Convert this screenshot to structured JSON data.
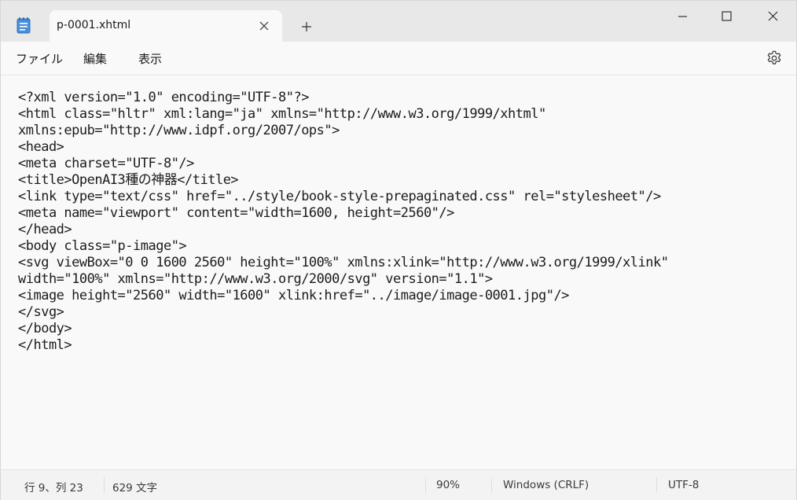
{
  "window": {
    "tab_title": "p-0001.xhtml",
    "new_tab_label": "+"
  },
  "menu": {
    "file": "ファイル",
    "edit": "編集",
    "view": "表示"
  },
  "editor": {
    "lines": [
      "<?xml version=\"1.0\" encoding=\"UTF-8\"?>",
      "<html class=\"hltr\" xml:lang=\"ja\" xmlns=\"http://www.w3.org/1999/xhtml\"",
      "xmlns:epub=\"http://www.idpf.org/2007/ops\">",
      "<head>",
      "<meta charset=\"UTF-8\"/>",
      "<title>OpenAI3種の神器</title>",
      "<link type=\"text/css\" href=\"../style/book-style-prepaginated.css\" rel=\"stylesheet\"/>",
      "<meta name=\"viewport\" content=\"width=1600, height=2560\"/>",
      "</head>",
      "<body class=\"p-image\">",
      "<svg viewBox=\"0 0 1600 2560\" height=\"100%\" xmlns:xlink=\"http://www.w3.org/1999/xlink\"",
      "width=\"100%\" xmlns=\"http://www.w3.org/2000/svg\" version=\"1.1\">",
      "<image height=\"2560\" width=\"1600\" xlink:href=\"../image/image-0001.jpg\"/>",
      "</svg>",
      "</body>",
      "</html>"
    ]
  },
  "status": {
    "position": "行 9、列 23",
    "char_count": "629 文字",
    "zoom": "90%",
    "line_ending": "Windows (CRLF)",
    "encoding": "UTF-8"
  },
  "icons": {
    "app": "notepad-icon",
    "close_tab": "close-icon",
    "new_tab": "plus-icon",
    "minimize": "minimize-icon",
    "maximize": "maximize-icon",
    "close_window": "close-icon",
    "settings": "gear-icon"
  },
  "colors": {
    "titlebar": "#e8e8e8",
    "surface": "#f9f9f9",
    "accent": "#3b7bd4"
  }
}
